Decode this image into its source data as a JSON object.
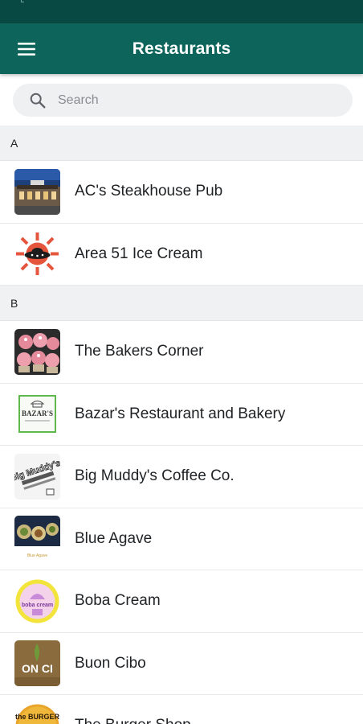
{
  "header": {
    "title": "Restaurants"
  },
  "search": {
    "placeholder": "Search"
  },
  "sections": [
    {
      "letter": "A",
      "items": [
        {
          "name": "AC's Steakhouse Pub",
          "icon": "restaurant-photo"
        },
        {
          "name": "Area 51 Ice Cream",
          "icon": "ufo-logo"
        }
      ]
    },
    {
      "letter": "B",
      "items": [
        {
          "name": "The Bakers Corner",
          "icon": "cupcakes-photo"
        },
        {
          "name": "Bazar's Restaurant and Bakery",
          "icon": "bazars-logo",
          "logo_text": "BAZAR'S"
        },
        {
          "name": "Big Muddy's Coffee Co.",
          "icon": "big-muddys-logo",
          "logo_text": "Big Muddy's"
        },
        {
          "name": "Blue Agave",
          "icon": "plates-photo",
          "logo_text": "Blue Agave"
        },
        {
          "name": "Boba Cream",
          "icon": "boba-cream-logo",
          "logo_text": "boba cream"
        },
        {
          "name": "Buon Cibo",
          "icon": "buon-cibo-logo",
          "logo_text": "ON CI"
        },
        {
          "name": "The Burger Shop",
          "icon": "burger-shop-logo",
          "logo_text": "the BURGER"
        }
      ]
    }
  ],
  "colors": {
    "status_bar": "#084a43",
    "app_bar": "#0c645a",
    "section_bg": "#eff1f3"
  }
}
